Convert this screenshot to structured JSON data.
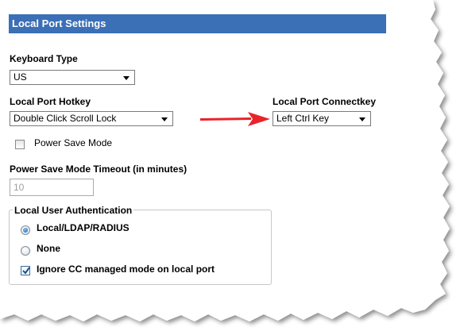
{
  "section": {
    "title": "Local Port Settings"
  },
  "keyboard_type": {
    "label": "Keyboard Type",
    "value": "US"
  },
  "local_port_hotkey": {
    "label": "Local Port Hotkey",
    "value": "Double Click Scroll Lock"
  },
  "local_port_connectkey": {
    "label": "Local Port Connectkey",
    "value": "Left Ctrl Key"
  },
  "power_save_mode": {
    "label": "Power Save Mode",
    "checked": false
  },
  "power_save_timeout": {
    "label": "Power Save Mode Timeout (in minutes)",
    "value": "10"
  },
  "local_user_auth": {
    "legend": "Local User Authentication",
    "options": [
      {
        "label": "Local/LDAP/RADIUS",
        "selected": true
      },
      {
        "label": "None",
        "selected": false
      }
    ],
    "ignore_cc": {
      "label": "Ignore CC managed mode on local port",
      "checked": true
    }
  },
  "colors": {
    "header_bg": "#3b6fb6",
    "arrow": "#e8232a"
  },
  "icons": [
    "dropdown-caret-icon",
    "red-arrow-icon",
    "checkmark-icon"
  ]
}
